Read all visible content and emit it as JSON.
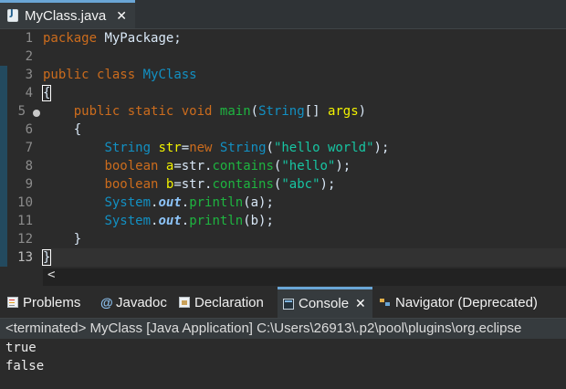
{
  "editor_tab": {
    "title": "MyClass.java",
    "close": "✕"
  },
  "line_numbers": [
    "1",
    "2",
    "3",
    "4",
    "5",
    "6",
    "7",
    "8",
    "9",
    "10",
    "11",
    "12",
    "13"
  ],
  "code": {
    "l1": {
      "kw": "package",
      "rest": " MyPackage;"
    },
    "l3": {
      "kw1": "public",
      "kw2": "class",
      "cls": "MyClass"
    },
    "l4": {
      "brace": "{"
    },
    "l5": {
      "kw1": "public",
      "kw2": "static",
      "kw3": "void",
      "mth": "main",
      "p1": "(",
      "cls": "String",
      "p2": "[] ",
      "var": "args",
      "p3": ")"
    },
    "l6": {
      "brace": "{"
    },
    "l7": {
      "cls1": "String",
      "var": "str",
      "p1": "=",
      "kw": "new",
      "cls2": "String",
      "p2": "(",
      "str": "\"hello world\"",
      "p3": ");"
    },
    "l8": {
      "kw": "boolean",
      "var": "a",
      "p1": "=str.",
      "mth": "contains",
      "p2": "(",
      "str": "\"hello\"",
      "p3": ");"
    },
    "l9": {
      "kw": "boolean",
      "var": "b",
      "p1": "=str.",
      "mth": "contains",
      "p2": "(",
      "str": "\"abc\"",
      "p3": ");"
    },
    "l10": {
      "cls": "System",
      "dot1": ".",
      "fld": "out",
      "dot2": ".",
      "mth": "println",
      "arg": "(a);"
    },
    "l11": {
      "cls": "System",
      "dot1": ".",
      "fld": "out",
      "dot2": ".",
      "mth": "println",
      "arg": "(b);"
    },
    "l12": {
      "brace": "}"
    },
    "l13": {
      "brace": "}"
    }
  },
  "scrollbar": {
    "left_arrow": "<"
  },
  "views": {
    "tabs": [
      {
        "label": "Problems"
      },
      {
        "label": "Javadoc"
      },
      {
        "label": "Declaration"
      },
      {
        "label": "Console",
        "active": true,
        "close": "✕"
      },
      {
        "label": "Navigator (Deprecated)"
      }
    ]
  },
  "console": {
    "status": "<terminated> MyClass [Java Application] C:\\Users\\26913\\.p2\\pool\\plugins\\org.eclipse",
    "output": [
      "true",
      "false"
    ]
  },
  "colors": {
    "background": "#2b2b2b",
    "keyword": "#cc6c1d",
    "class": "#1290c3",
    "string": "#17c6a3",
    "method": "#1eb540",
    "variable": "#f2f200",
    "field": "#8dc4f8",
    "accent": "#6aa6d6"
  }
}
